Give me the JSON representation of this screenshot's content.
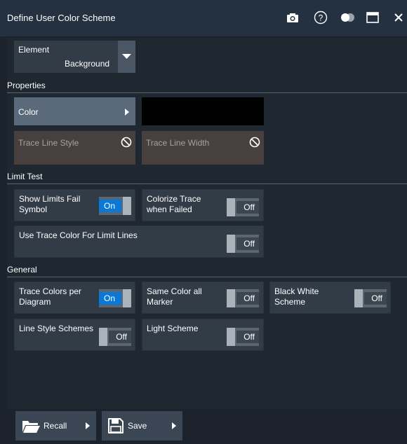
{
  "window": {
    "title": "Define User Color Scheme",
    "icons": [
      "camera-icon",
      "help-icon",
      "toggle-icon",
      "maximize-icon",
      "close-icon"
    ]
  },
  "element": {
    "label": "Element",
    "value": "Background"
  },
  "sections": {
    "properties": "Properties",
    "limit_test": "Limit Test",
    "general": "General"
  },
  "properties": {
    "color_label": "Color",
    "color_value": "#000000",
    "trace_line_style": "Trace Line Style",
    "trace_line_width": "Trace Line Width"
  },
  "limit_test": {
    "show_limits_fail_symbol": {
      "label": "Show Limits Fail Symbol",
      "state": "On"
    },
    "colorize_trace": {
      "label": "Colorize Trace when Failed",
      "state": "Off"
    },
    "use_trace_color": {
      "label": "Use Trace Color For Limit Lines",
      "state": "Off"
    }
  },
  "general": {
    "trace_colors_per_diagram": {
      "label": "Trace Colors per Diagram",
      "state": "On"
    },
    "same_color_all_marker": {
      "label": "Same Color all Marker",
      "state": "Off"
    },
    "black_white_scheme": {
      "label": "Black White Scheme",
      "state": "Off"
    },
    "line_style_schemes": {
      "label": "Line Style Schemes",
      "state": "Off"
    },
    "light_scheme": {
      "label": "Light Scheme",
      "state": "Off"
    }
  },
  "bottom": {
    "recall": "Recall",
    "save": "Save"
  },
  "colors": {
    "accent": "#0a78d7",
    "tile": "#323c47",
    "header": "#243140"
  }
}
